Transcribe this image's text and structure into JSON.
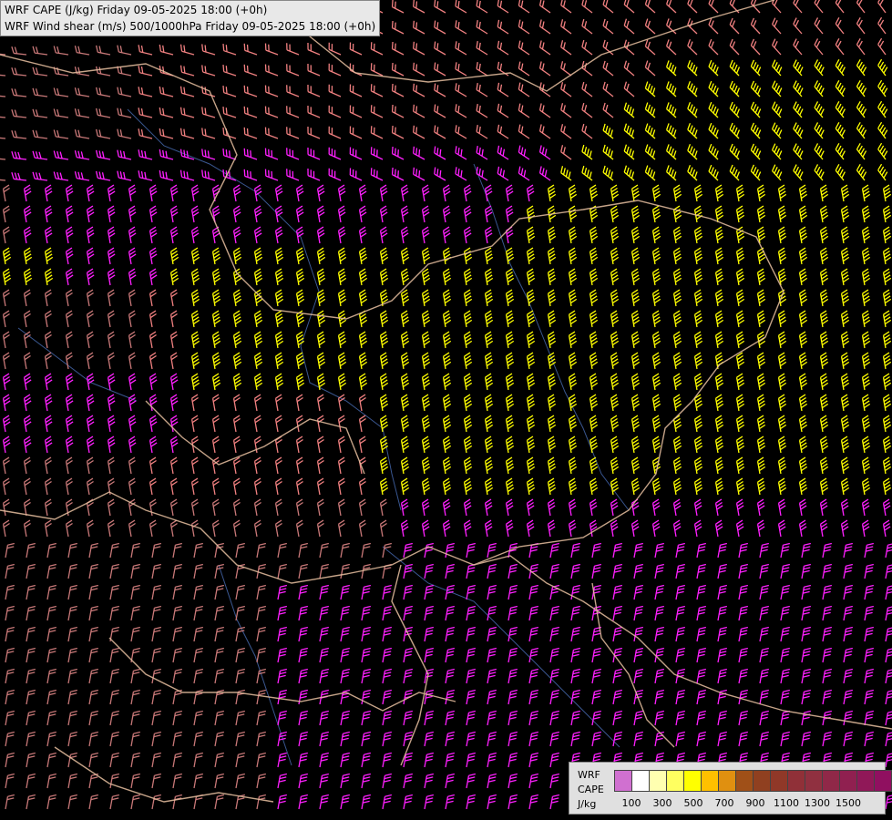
{
  "titles": {
    "line1": "WRF CAPE (J/kg) Friday 09-05-2025 18:00 (+0h)",
    "line2": "WRF Wind shear (m/s) 500/1000hPa Friday 09-05-2025 18:00 (+0h)"
  },
  "legend": {
    "labels": [
      "WRF",
      "CAPE",
      "J/kg"
    ],
    "swatch_colors": [
      "#d070d0",
      "#ffffff",
      "#ffffb0",
      "#ffff60",
      "#ffff00",
      "#ffc000",
      "#e09010",
      "#a05018",
      "#904020",
      "#903828",
      "#903038",
      "#903040",
      "#902848",
      "#902050",
      "#901858",
      "#901060",
      "#900868",
      "#900070"
    ],
    "ticks": [
      "100",
      "300",
      "500",
      "700",
      "900",
      "1100",
      "1300",
      "1500"
    ]
  },
  "colors": {
    "background": "#000000",
    "barb_weak": "#c87878",
    "barb_moderate": "#f08080",
    "barb_strong": "#ff20ff",
    "barb_high_cape": "#ffff00",
    "borders": "#e8c0a0",
    "rivers": "#4060a0"
  }
}
